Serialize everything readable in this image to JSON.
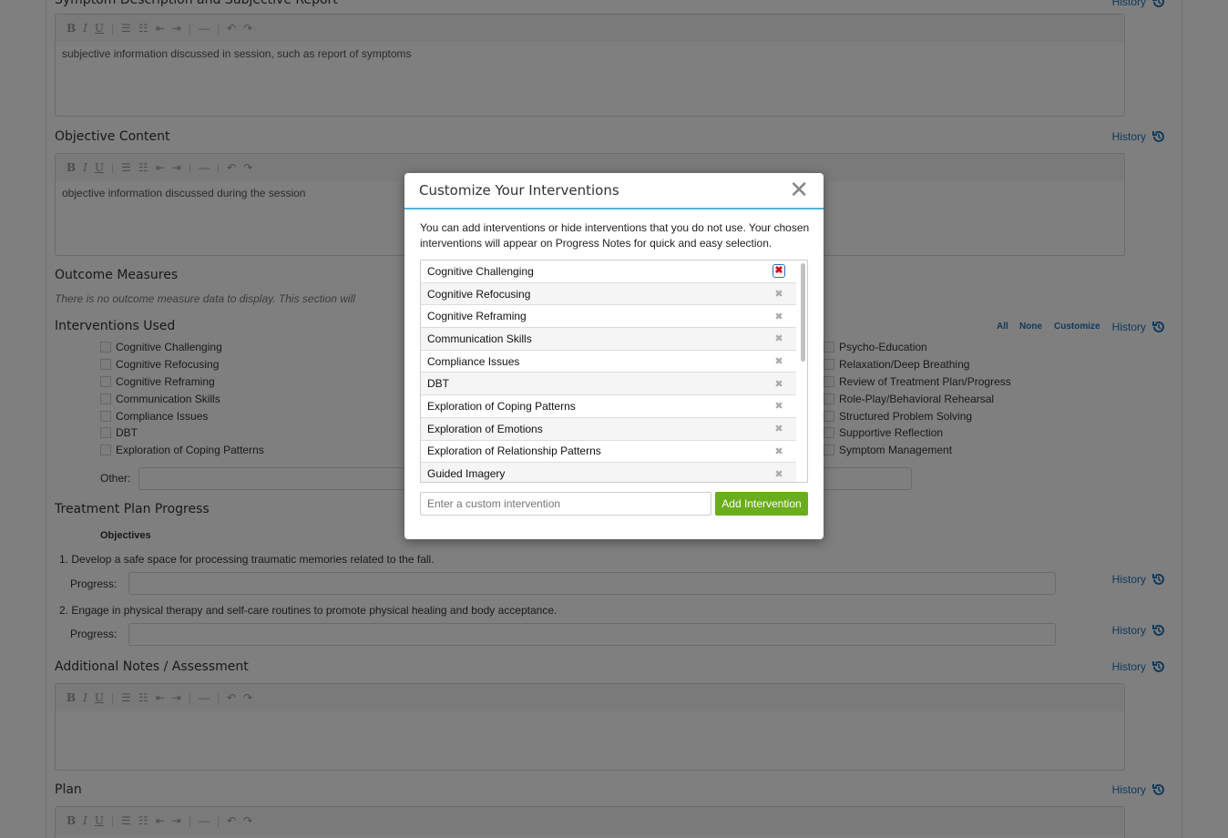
{
  "history_label": "History",
  "editor_toolbar": {
    "bold": "B",
    "italic": "I",
    "underline": "U",
    "sep": "|",
    "hr": "—",
    "undo": "↶",
    "redo": "↷"
  },
  "symptom": {
    "title": "Symptom Description and Subjective Report",
    "text": "subjective information discussed in session, such as report of symptoms"
  },
  "objective": {
    "title": "Objective Content",
    "text": "objective information discussed during the session"
  },
  "outcome": {
    "title": "Outcome Measures",
    "text": "There is no outcome measure data to display. This section will"
  },
  "interventions": {
    "title": "Interventions Used",
    "links": {
      "all": "All",
      "none": "None",
      "customize": "Customize"
    },
    "left_items": [
      "Cognitive Challenging",
      "Cognitive Refocusing",
      "Cognitive Reframing",
      "Communication Skills",
      "Compliance Issues",
      "DBT",
      "Exploration of Coping Patterns"
    ],
    "right_items": [
      "Psycho-Education",
      "Relaxation/Deep Breathing",
      "Review of Treatment Plan/Progress",
      "Role-Play/Behavioral Rehearsal",
      "Structured Problem Solving",
      "Supportive Reflection",
      "Symptom Management"
    ],
    "other_label": "Other:"
  },
  "treatment": {
    "title": "Treatment Plan Progress",
    "objectives_label": "Objectives",
    "progress_label": "Progress:",
    "objectives": [
      "1. Develop a safe space for processing traumatic memories related to the fall.",
      "2. Engage in physical therapy and self-care routines to promote physical healing and body acceptance."
    ]
  },
  "additional": {
    "title": "Additional Notes / Assessment"
  },
  "plan": {
    "title": "Plan"
  },
  "modal": {
    "title": "Customize Your Interventions",
    "close": "✕",
    "description": "You can add interventions or hide interventions that you do not use. Your chosen interventions will appear on Progress Notes for quick and easy selection.",
    "items": [
      "Cognitive Challenging",
      "Cognitive Refocusing",
      "Cognitive Reframing",
      "Communication Skills",
      "Compliance Issues",
      "DBT",
      "Exploration of Coping Patterns",
      "Exploration of Emotions",
      "Exploration of Relationship Patterns",
      "Guided Imagery"
    ],
    "remove_symbol": "✖",
    "input_placeholder": "Enter a custom intervention",
    "add_button": "Add Intervention"
  },
  "colors": {
    "link": "#1f72b8",
    "accent_green": "#6aad1d",
    "header_rule": "#4fb3d9"
  }
}
